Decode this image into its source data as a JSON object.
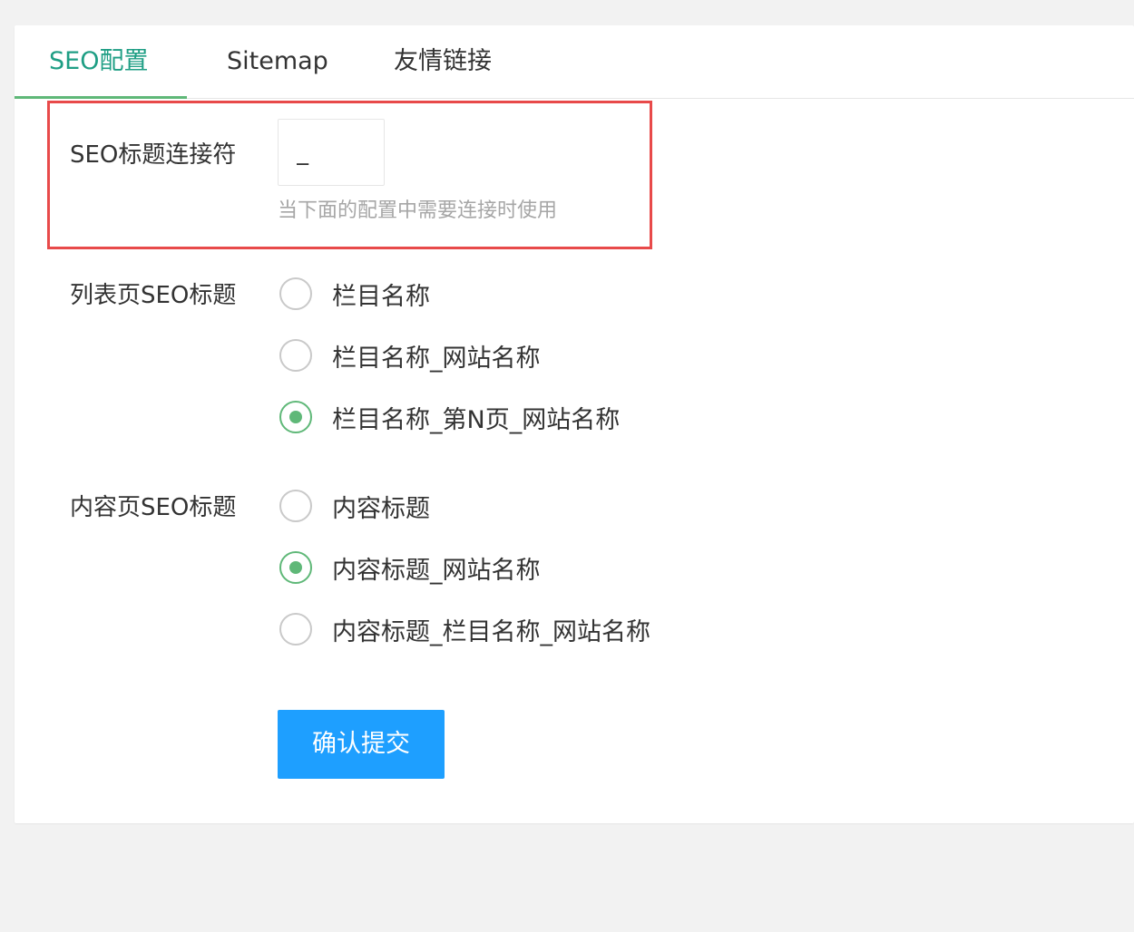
{
  "tabs": [
    {
      "label": "SEO配置",
      "active": true
    },
    {
      "label": "Sitemap",
      "active": false
    },
    {
      "label": "友情链接",
      "active": false
    }
  ],
  "form": {
    "separator": {
      "label": "SEO标题连接符",
      "value": "_",
      "hint": "当下面的配置中需要连接时使用"
    },
    "list_title": {
      "label": "列表页SEO标题",
      "options": [
        {
          "label": "栏目名称",
          "checked": false
        },
        {
          "label": "栏目名称_网站名称",
          "checked": false
        },
        {
          "label": "栏目名称_第N页_网站名称",
          "checked": true
        }
      ]
    },
    "content_title": {
      "label": "内容页SEO标题",
      "options": [
        {
          "label": "内容标题",
          "checked": false
        },
        {
          "label": "内容标题_网站名称",
          "checked": true
        },
        {
          "label": "内容标题_栏目名称_网站名称",
          "checked": false
        }
      ]
    },
    "submit_label": "确认提交"
  },
  "colors": {
    "active_tab": "#1e9e84",
    "radio_checked": "#5fb878",
    "submit_button": "#1e9fff",
    "highlight_border": "#e84a4a"
  }
}
